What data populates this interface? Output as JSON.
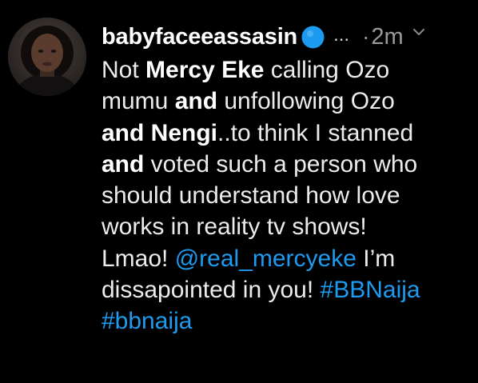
{
  "tweet": {
    "author": {
      "display_name": "babyfaceeassasin",
      "verified_icon": "verified-badge-icon",
      "avatar": "profile-photo"
    },
    "more": "...",
    "separator": "·",
    "time": "2m",
    "menu_icon": "chevron-down-icon",
    "lines": [
      [
        {
          "text": "Not ",
          "style": "normal"
        },
        {
          "text": "Mercy Eke",
          "style": "bold"
        },
        {
          "text": " calling Ozo",
          "style": "normal"
        }
      ],
      [
        {
          "text": "mumu ",
          "style": "normal"
        },
        {
          "text": "and",
          "style": "bold"
        },
        {
          "text": " unfollowing Ozo",
          "style": "normal"
        }
      ],
      [
        {
          "text": "and Nengi",
          "style": "bold"
        },
        {
          "text": "..to think I stanned",
          "style": "normal"
        }
      ],
      [
        {
          "text": "and",
          "style": "bold"
        },
        {
          "text": " voted such a person who",
          "style": "normal"
        }
      ],
      [
        {
          "text": "should understand how love",
          "style": "normal"
        }
      ],
      [
        {
          "text": "works in reality tv shows!",
          "style": "normal"
        }
      ],
      [
        {
          "text": "Lmao! ",
          "style": "normal"
        },
        {
          "text": "@real_mercyeke",
          "style": "mention"
        },
        {
          "text": " I’m",
          "style": "normal"
        }
      ],
      [
        {
          "text": "dissapointed in you!  ",
          "style": "normal"
        },
        {
          "text": "#BBNaija",
          "style": "hashtag"
        }
      ],
      [
        {
          "text": "#bbnaija",
          "style": "hashtag"
        }
      ]
    ]
  },
  "colors": {
    "background": "#000000",
    "text": "#ececec",
    "link": "#1d9bf0",
    "verified": "#1d9bf0",
    "meta": "#9a9a9a"
  }
}
